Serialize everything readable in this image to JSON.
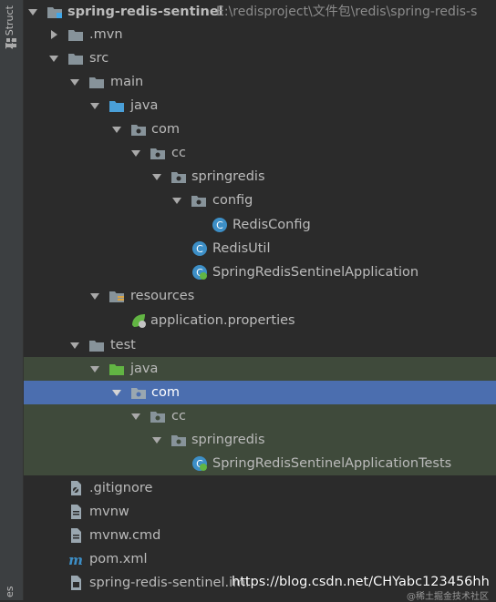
{
  "sidebar": {
    "structure_tab": "Z: Structure",
    "bottom_tab": "es"
  },
  "tree": {
    "root": {
      "name": "spring-redis-sentinel",
      "path": "E:\\redisproject\\文件包\\redis\\spring-redis-s"
    },
    "rows": [
      {
        "label": ".mvn",
        "icon": "folder-icon"
      },
      {
        "label": "src",
        "icon": "folder-icon"
      },
      {
        "label": "main",
        "icon": "folder-icon"
      },
      {
        "label": "java",
        "icon": "source-folder-icon"
      },
      {
        "label": "com",
        "icon": "package-icon"
      },
      {
        "label": "cc",
        "icon": "package-icon"
      },
      {
        "label": "springredis",
        "icon": "package-icon"
      },
      {
        "label": "config",
        "icon": "package-icon"
      },
      {
        "label": "RedisConfig",
        "icon": "class-icon"
      },
      {
        "label": "RedisUtil",
        "icon": "class-icon"
      },
      {
        "label": "SpringRedisSentinelApplication",
        "icon": "spring-boot-class-icon"
      },
      {
        "label": "resources",
        "icon": "resources-folder-icon"
      },
      {
        "label": "application.properties",
        "icon": "spring-properties-icon"
      },
      {
        "label": "test",
        "icon": "folder-icon"
      },
      {
        "label": "java",
        "icon": "test-source-folder-icon"
      },
      {
        "label": "com",
        "icon": "package-icon"
      },
      {
        "label": "cc",
        "icon": "package-icon"
      },
      {
        "label": "springredis",
        "icon": "package-icon"
      },
      {
        "label": "SpringRedisSentinelApplicationTests",
        "icon": "spring-boot-test-class-icon"
      },
      {
        "label": ".gitignore",
        "icon": "gitignore-file-icon"
      },
      {
        "label": "mvnw",
        "icon": "file-icon"
      },
      {
        "label": "mvnw.cmd",
        "icon": "file-icon"
      },
      {
        "label": "pom.xml",
        "icon": "maven-icon"
      },
      {
        "label": "spring-redis-sentinel.iml",
        "icon": "iml-file-icon"
      }
    ]
  },
  "watermark": {
    "url": "https://blog.csdn.net/CHYabc123456hh",
    "credit": "@稀土掘金技术社区"
  }
}
